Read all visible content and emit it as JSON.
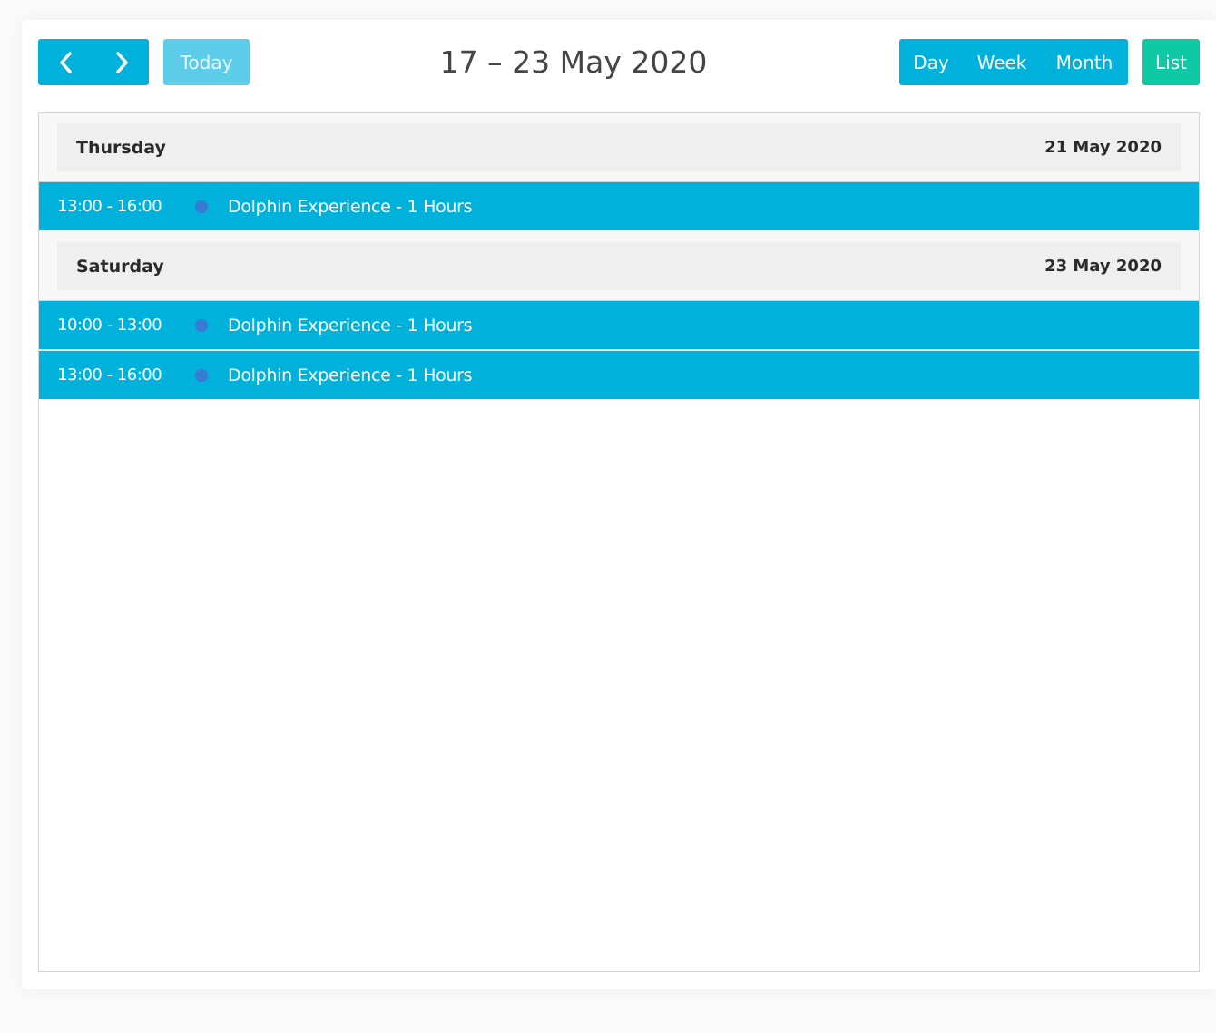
{
  "toolbar": {
    "prev_label": "‹",
    "next_label": "›",
    "today_label": "Today",
    "title": "17 – 23 May 2020",
    "views": [
      "Day",
      "Week",
      "Month"
    ],
    "list_label": "List"
  },
  "colors": {
    "primary": "#00b1db",
    "today_disabled": "#5ccde9",
    "list_active": "#0dcaa5",
    "event_dot": "#3a7ad4",
    "day_header_bg": "#efefef"
  },
  "days": [
    {
      "name": "Thursday",
      "date": "21 May 2020",
      "events": [
        {
          "time": "13:00 - 16:00",
          "title": "Dolphin Experience - 1 Hours"
        }
      ]
    },
    {
      "name": "Saturday",
      "date": "23 May 2020",
      "events": [
        {
          "time": "10:00 - 13:00",
          "title": "Dolphin Experience - 1 Hours"
        },
        {
          "time": "13:00 - 16:00",
          "title": "Dolphin Experience - 1 Hours"
        }
      ]
    }
  ]
}
